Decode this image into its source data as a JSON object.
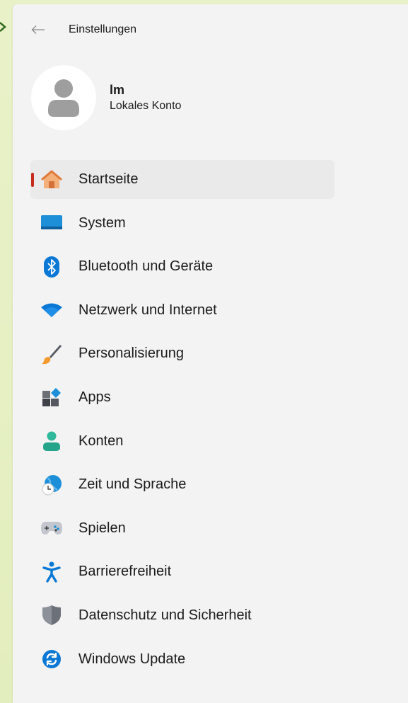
{
  "window": {
    "title": "Einstellungen"
  },
  "profile": {
    "name": "lm",
    "account_type": "Lokales Konto"
  },
  "nav": {
    "items": [
      {
        "label": "Startseite",
        "icon": "home-icon",
        "active": true
      },
      {
        "label": "System",
        "icon": "system-icon"
      },
      {
        "label": "Bluetooth und Geräte",
        "icon": "bluetooth-icon"
      },
      {
        "label": "Netzwerk und Internet",
        "icon": "wifi-icon"
      },
      {
        "label": "Personalisierung",
        "icon": "brush-icon"
      },
      {
        "label": "Apps",
        "icon": "apps-icon"
      },
      {
        "label": "Konten",
        "icon": "account-icon"
      },
      {
        "label": "Zeit und Sprache",
        "icon": "time-language-icon"
      },
      {
        "label": "Spielen",
        "icon": "gamepad-icon"
      },
      {
        "label": "Barrierefreiheit",
        "icon": "accessibility-icon"
      },
      {
        "label": "Datenschutz und Sicherheit",
        "icon": "shield-icon"
      },
      {
        "label": "Windows Update",
        "icon": "update-icon"
      }
    ]
  },
  "colors": {
    "accent_indicator": "#c42b1c",
    "window_bg": "#f3f3f3",
    "active_bg": "#eaeaea"
  }
}
